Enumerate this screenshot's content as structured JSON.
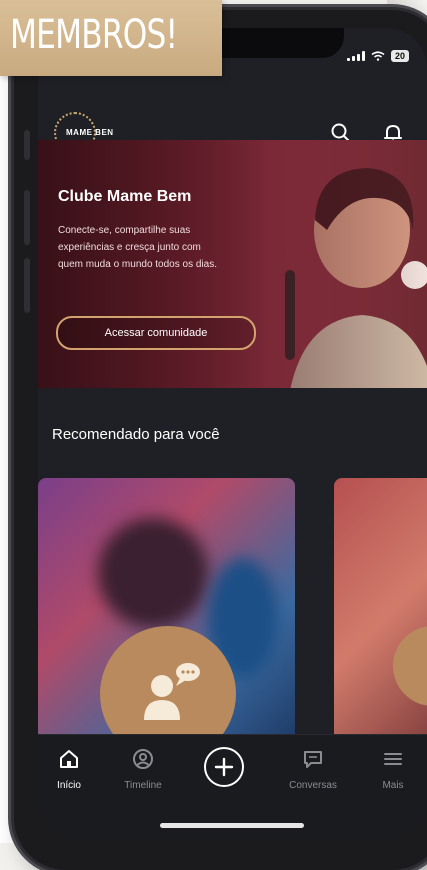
{
  "promo_banner": {
    "text": "MEMBROS!"
  },
  "status_bar": {
    "battery": "20"
  },
  "header": {
    "logo_text": "MAME BEN"
  },
  "hero": {
    "title": "Clube Mame Bem",
    "description": "Conecte-se, compartilhe suas experiências e cresça junto com quem muda o mundo todos os dias.",
    "cta_label": "Acessar comunidade"
  },
  "recommended": {
    "title": "Recomendado para você"
  },
  "nav": {
    "items": [
      {
        "label": "Início",
        "icon": "home-icon"
      },
      {
        "label": "Timeline",
        "icon": "timeline-icon"
      },
      {
        "label": "",
        "icon": "plus-circle-icon"
      },
      {
        "label": "Conversas",
        "icon": "chat-icon"
      },
      {
        "label": "Mais",
        "icon": "menu-icon"
      }
    ]
  },
  "colors": {
    "accent": "#c9a46f",
    "background": "#1f2025",
    "hero": "#8a2b3a"
  }
}
